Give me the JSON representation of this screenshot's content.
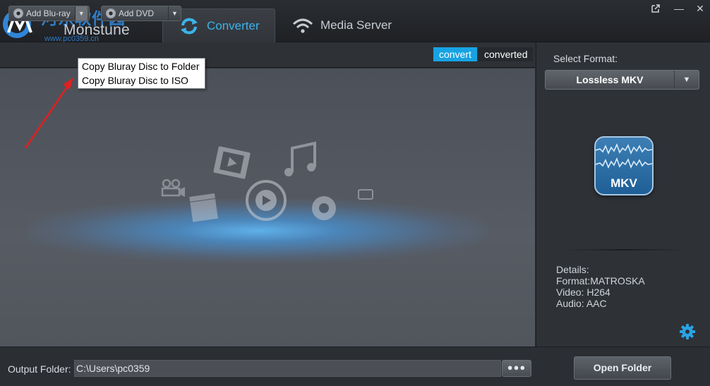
{
  "app": {
    "brand": "Monstune",
    "watermark_title": "河东软件园",
    "watermark_url": "www.pc0359.cn"
  },
  "tabs": [
    {
      "label": "Converter",
      "icon": "refresh-icon",
      "active": true
    },
    {
      "label": "Media Server",
      "icon": "wifi-icon",
      "active": false
    }
  ],
  "window_controls": {
    "restore_icon": "external-link-icon",
    "minimize": "—",
    "close": "✕"
  },
  "toolbar": {
    "add_bluray": "Add Blu-ray",
    "add_dvd": "Add DVD",
    "arrow": "▼",
    "convert_tab": "convert",
    "converted_tab": "converted"
  },
  "dropdown_menu": {
    "items": [
      "Copy Bluray Disc to Folder",
      "Copy Bluray Disc to ISO"
    ]
  },
  "right_panel": {
    "select_format_label": "Select Format:",
    "selected_format": "Lossless MKV",
    "format_icon_label": "MKV",
    "details": {
      "title": "Details:",
      "format": "Format:MATROSKA",
      "video": "Video: H264",
      "audio": "Audio: AAC"
    }
  },
  "bottom": {
    "output_folder_label": "Output Folder:",
    "output_folder_value": "C:\\Users\\pc0359",
    "browse_label": "●●●",
    "open_folder_label": "Open Folder"
  },
  "colors": {
    "accent": "#3bb3ea",
    "convert_active": "#17a3e3",
    "annotation_arrow": "#e02020"
  }
}
